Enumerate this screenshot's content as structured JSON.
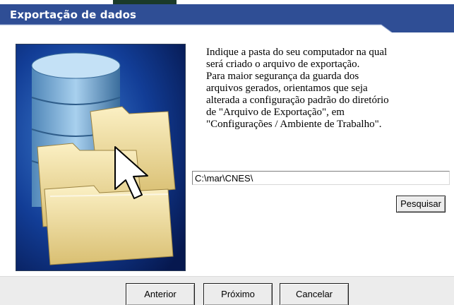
{
  "window": {
    "title": "Exportação de dados"
  },
  "instructions": {
    "text": "Indique a pasta do seu computador na qual\nserá criado o arquivo de exportação.\nPara maior segurança da guarda dos\narquivos gerados, orientamos que seja\nalterada a  configuração padrão do diretório\nde \"Arquivo de  Exportação\", em\n \"Configurações / Ambiente de Trabalho\"."
  },
  "path_input": {
    "value": "C:\\mar\\CNES\\"
  },
  "buttons": {
    "search": "Pesquisar",
    "previous": "Anterior",
    "next": "Próximo",
    "cancel": "Cancelar"
  },
  "illustration": {
    "icons": [
      "database-icon",
      "folder-icon",
      "mouse-cursor-icon"
    ]
  },
  "colors": {
    "title_bar": "#2f4e95",
    "illustration_background": "#0b2a7a",
    "folder": "#f2dfa0",
    "database": "#7fb6dc"
  }
}
